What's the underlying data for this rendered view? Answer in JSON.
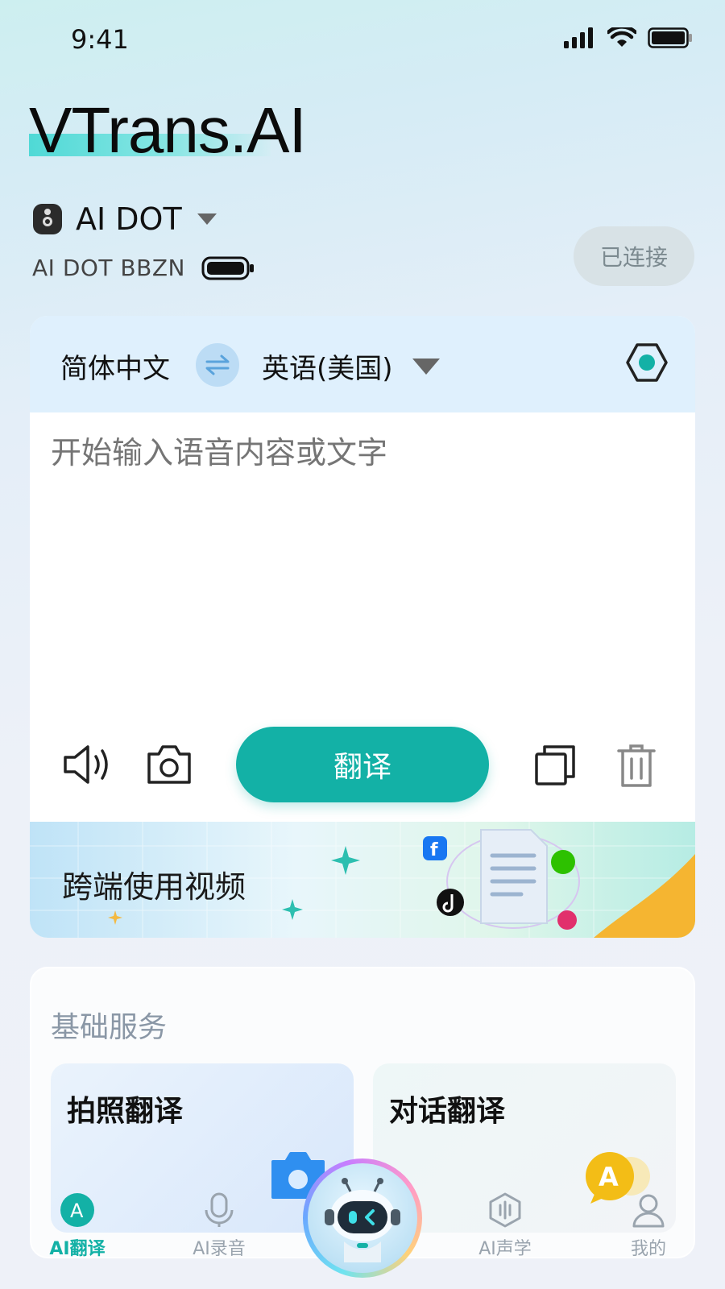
{
  "status_bar": {
    "time": "9:41"
  },
  "brand": {
    "title": "VTrans.AI"
  },
  "device": {
    "name": "AI DOT",
    "id": "AI DOT BBZN",
    "connection_status": "已连接"
  },
  "translator": {
    "source_language": "简体中文",
    "target_language": "英语(美国)",
    "input_placeholder": "开始输入语音内容或文字",
    "translate_label": "翻译",
    "banner_text": "跨端使用视频"
  },
  "services": {
    "title": "基础服务",
    "items": [
      {
        "label": "拍照翻译"
      },
      {
        "label": "对话翻译"
      }
    ]
  },
  "nav": {
    "items": [
      {
        "label": "AI翻译",
        "icon": "translate-icon",
        "active": true
      },
      {
        "label": "AI录音",
        "icon": "microphone-icon",
        "active": false
      },
      {
        "label": "AI声学",
        "icon": "acoustics-icon",
        "active": false
      },
      {
        "label": "我的",
        "icon": "profile-icon",
        "active": false
      }
    ]
  },
  "colors": {
    "accent": "#13b1a6",
    "lang_bar": "#dff0fd",
    "connected_bg": "#d8e2e6"
  }
}
